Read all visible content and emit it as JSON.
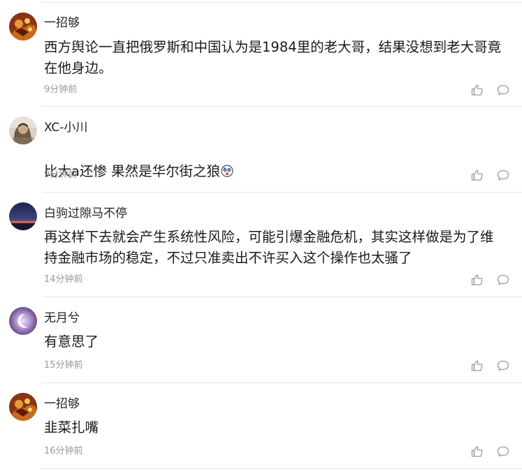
{
  "comments": [
    {
      "username": "一招够",
      "avatar_icon": "character-avatar-icon",
      "text": "西方舆论一直把俄罗斯和中国认为是1984里的老大哥，结果没想到老大哥竟\n在他身边。",
      "timestamp": "9分钟前"
    },
    {
      "username": "XC-小川",
      "avatar_icon": "photo-avatar-icon",
      "text": "比大a还惨 果然是华尔街之狼",
      "timestamp": "9分钟前",
      "trailing_emoji": "surprised-face-emoji"
    },
    {
      "username": "白驹过隙马不停",
      "avatar_icon": "sunset-avatar-icon",
      "text": "再这样下去就会产生系统性风险，可能引爆金融危机，其实这样做是为了维\n持金融市场的稳定，不过只准卖出不许买入这个操作也太骚了",
      "timestamp": "14分钟前"
    },
    {
      "username": "无月兮",
      "avatar_icon": "moon-avatar-icon",
      "text": "有意思了",
      "timestamp": "15分钟前"
    },
    {
      "username": "一招够",
      "avatar_icon": "character-avatar-icon",
      "text": "韭菜扎嘴",
      "timestamp": "16分钟前"
    }
  ],
  "colors": {
    "text": "#1a1a1a",
    "username": "#222222",
    "timestamp": "#999999",
    "icon": "#9a9a9a",
    "divider": "#e6e6e6"
  },
  "icons": {
    "like": "thumbs-up-icon",
    "reply": "comment-bubble-icon"
  }
}
